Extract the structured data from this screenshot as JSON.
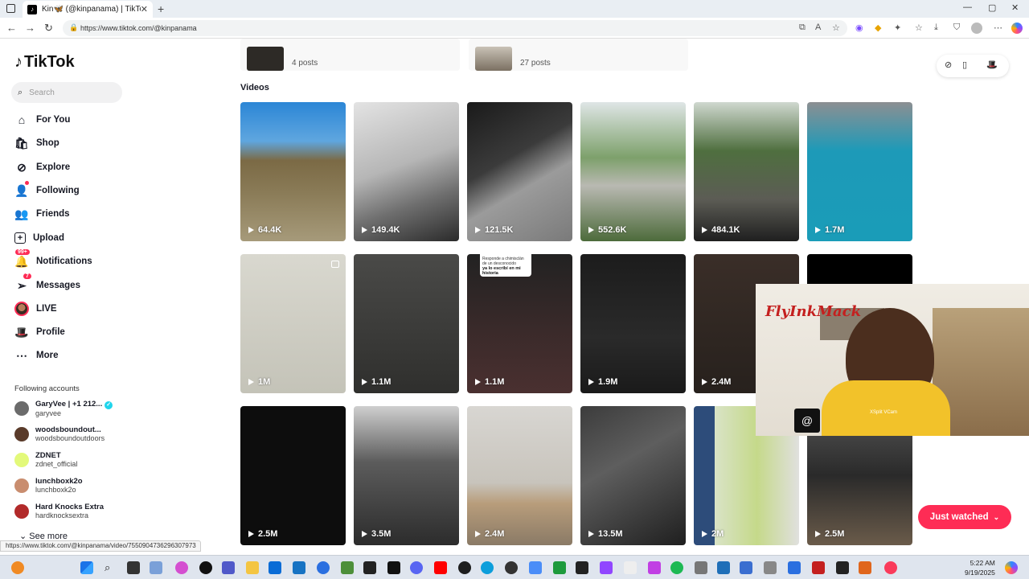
{
  "browser": {
    "tab_title": "Kin🦋 (@kinpanama) | TikTok",
    "url": "https://www.tiktok.com/@kinpanama",
    "status_url": "https://www.tiktok.com/@kinpanama/video/7550904736296307973"
  },
  "sidebar": {
    "logo": "TikTok",
    "search_placeholder": "Search",
    "nav": [
      {
        "label": "For You",
        "icon": "home-icon"
      },
      {
        "label": "Shop",
        "icon": "shop-icon"
      },
      {
        "label": "Explore",
        "icon": "compass-icon"
      },
      {
        "label": "Following",
        "icon": "following-icon"
      },
      {
        "label": "Friends",
        "icon": "friends-icon"
      },
      {
        "label": "Upload",
        "icon": "upload-icon"
      },
      {
        "label": "Notifications",
        "icon": "bell-icon",
        "badge": "99+"
      },
      {
        "label": "Messages",
        "icon": "send-icon",
        "badge": "7"
      },
      {
        "label": "LIVE",
        "icon": "live-icon"
      },
      {
        "label": "Profile",
        "icon": "profile-icon"
      },
      {
        "label": "More",
        "icon": "more-icon"
      }
    ],
    "following_heading": "Following accounts",
    "accounts": [
      {
        "name": "GaryVee | +1 212...",
        "username": "garyvee",
        "verified": true
      },
      {
        "name": "woodsboundout...",
        "username": "woodsboundoutdoors"
      },
      {
        "name": "ZDNET",
        "username": "zdnet_official"
      },
      {
        "name": "lunchboxk2o",
        "username": "lunchboxk2o"
      },
      {
        "name": "Hard Knocks Extra",
        "username": "hardknocksextra"
      }
    ],
    "see_more": "See more"
  },
  "playlists": [
    {
      "count": "4 posts"
    },
    {
      "count": "27 posts"
    }
  ],
  "videos_heading": "Videos",
  "videos": [
    {
      "views": "64.4K"
    },
    {
      "views": "149.4K"
    },
    {
      "views": "121.5K"
    },
    {
      "views": "552.6K"
    },
    {
      "views": "484.1K"
    },
    {
      "views": "1.7M"
    },
    {
      "views": "1M"
    },
    {
      "views": "1.1M"
    },
    {
      "views": "1.1M"
    },
    {
      "views": "1.9M"
    },
    {
      "views": "2.4M"
    },
    {
      "views": ""
    },
    {
      "views": "2.5M"
    },
    {
      "views": "3.5M"
    },
    {
      "views": "2.4M"
    },
    {
      "views": "13.5M"
    },
    {
      "views": "2M"
    },
    {
      "views": "2.5M"
    }
  ],
  "caption_overlay": {
    "small": "Responde a chimisclán de un desconocido",
    "bold": "ya lo escribí en mi historia"
  },
  "webcam": {
    "brand": "FlyInkMack",
    "tag": "XSplit VCam"
  },
  "just_watched": "Just watched",
  "taskbar": {
    "time": "5:22 AM",
    "date": "9/19/2025"
  }
}
